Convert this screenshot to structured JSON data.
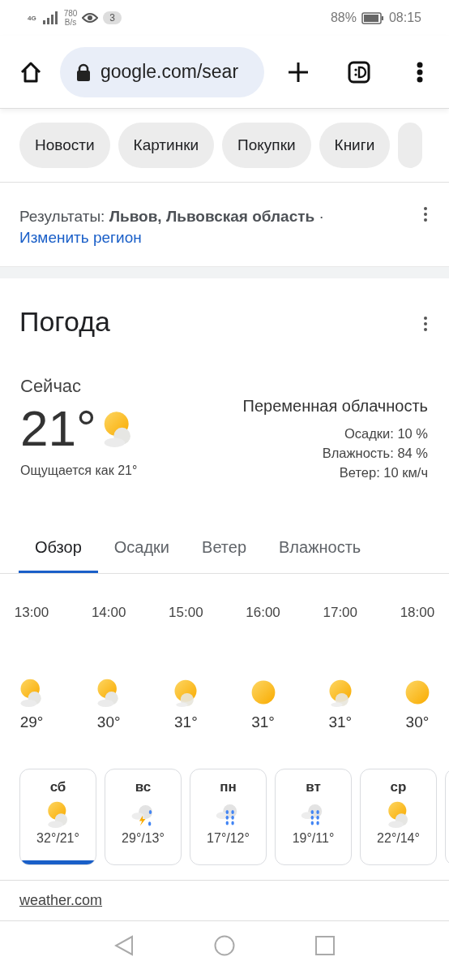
{
  "status_bar": {
    "network": "4G",
    "speed_value": "780",
    "speed_unit": "B/s",
    "notification_count": "3",
    "battery": "88%",
    "time": "08:15"
  },
  "toolbar": {
    "url": "google.com/sear"
  },
  "chips": [
    {
      "label": "Новости"
    },
    {
      "label": "Картинки"
    },
    {
      "label": "Покупки"
    },
    {
      "label": "Книги"
    }
  ],
  "location": {
    "prefix": "Результаты: ",
    "place": "**Львов, Львовская область** ·",
    "change_link": "Изменить регион"
  },
  "weather": {
    "title": "Погода",
    "now": {
      "label": "Сейчас",
      "temperature": "21°",
      "kind": "partly_cloudy",
      "feels_like": "Ощущается как 21°"
    },
    "condition": "Переменная облачность",
    "details": [
      "Осадки: 10 %",
      "Влажность: 84 %",
      "Ветер: 10 км/ч"
    ],
    "tabs": [
      {
        "label": "Обзор",
        "selected": true
      },
      {
        "label": "Осадки",
        "selected": false
      },
      {
        "label": "Ветер",
        "selected": false
      },
      {
        "label": "Влажность",
        "selected": false
      }
    ],
    "hours": [
      {
        "time": "13:00",
        "kind": "partly_cloudy",
        "temp": "29°"
      },
      {
        "time": "14:00",
        "kind": "partly_cloudy",
        "temp": "30°"
      },
      {
        "time": "15:00",
        "kind": "mostly_sunny",
        "temp": "31°"
      },
      {
        "time": "16:00",
        "kind": "sunny",
        "temp": "31°"
      },
      {
        "time": "17:00",
        "kind": "mostly_sunny",
        "temp": "31°"
      },
      {
        "time": "18:00",
        "kind": "sunny",
        "temp": "30°"
      }
    ],
    "days": [
      {
        "day": "сб",
        "kind": "partly_cloudy",
        "temps": "32°/21°",
        "selected": true
      },
      {
        "day": "вс",
        "kind": "thunder_rain",
        "temps": "29°/13°",
        "selected": false
      },
      {
        "day": "пн",
        "kind": "rain",
        "temps": "17°/12°",
        "selected": false
      },
      {
        "day": "вт",
        "kind": "rain",
        "temps": "19°/11°",
        "selected": false
      },
      {
        "day": "ср",
        "kind": "partly_cloudy",
        "temps": "22°/14°",
        "selected": false
      }
    ],
    "source": "weather.com"
  }
}
